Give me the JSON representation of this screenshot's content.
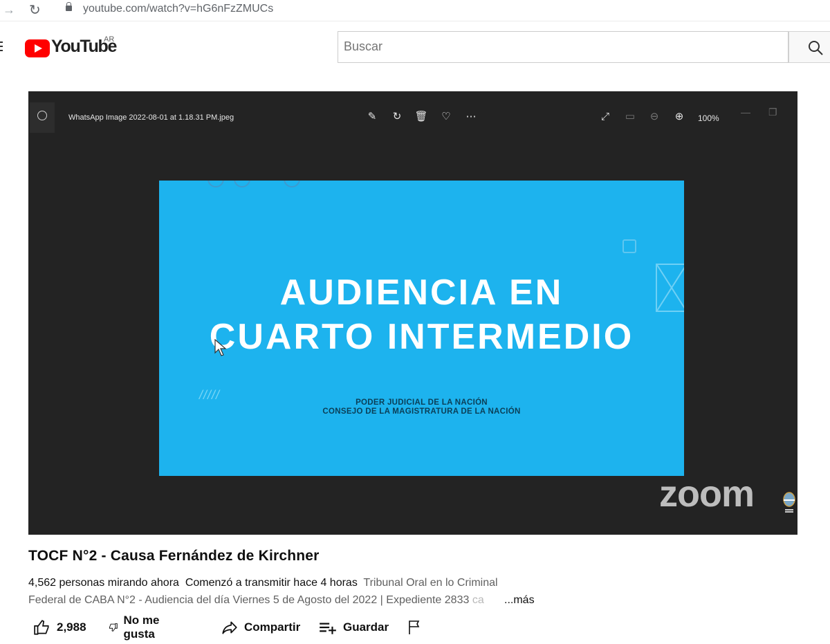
{
  "browser": {
    "url": "youtube.com/watch?v=hG6nFzZMUCs"
  },
  "masthead": {
    "logo_text": "YouTube",
    "region": "AR",
    "search_placeholder": "Buscar"
  },
  "viewer": {
    "filename": "WhatsApp Image 2022-08-01 at 1.18.31 PM.jpeg",
    "zoom_level": "100%"
  },
  "slide": {
    "title_line1": "AUDIENCIA EN",
    "title_line2": "CUARTO INTERMEDIO",
    "sub_line1": "PODER JUDICIAL DE LA NACIÓN",
    "sub_line2": "CONSEJO DE LA MAGISTRATURA DE LA NACIÓN",
    "hatch": "/////",
    "overlay_logo": "zoom"
  },
  "video": {
    "title": "TOCF N°2 - Causa Fernández de Kirchner",
    "watching": "4,562 personas mirando ahora",
    "started": "Comenzó a transmitir hace 4 horas",
    "desc_line1": "Tribunal Oral en lo Criminal",
    "desc_line2": "Federal de CABA N°2 - Audiencia del día Viernes 5 de Agosto del 2022 | Expediente 2833 ",
    "desc_fade": "ca",
    "more": "...más"
  },
  "actions": {
    "like_count": "2,988",
    "dislike_label": "No me gusta",
    "share_label": "Compartir",
    "save_label": "Guardar"
  },
  "colors": {
    "slide_bg": "#1db3ee",
    "player_bg": "#232323",
    "yt_red": "#ff0000"
  }
}
